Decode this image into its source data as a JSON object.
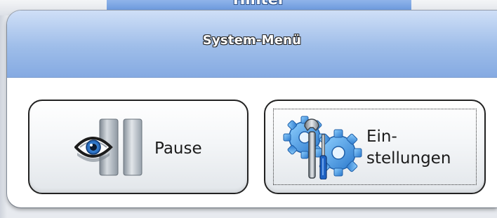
{
  "background": {
    "tab_label": "Hinter"
  },
  "dialog": {
    "title": "System-Menü",
    "buttons": [
      {
        "label": "Pause",
        "icon": "eye-pause-icon"
      },
      {
        "label_line1": "Ein-",
        "label_line2": "stellungen",
        "icon": "gear-wrench-icon"
      }
    ]
  },
  "colors": {
    "titlebar": "#9ebde9",
    "background_tab": "#6f9ae0",
    "button_border": "#222222",
    "icon_blue": "#3d8fe0"
  }
}
